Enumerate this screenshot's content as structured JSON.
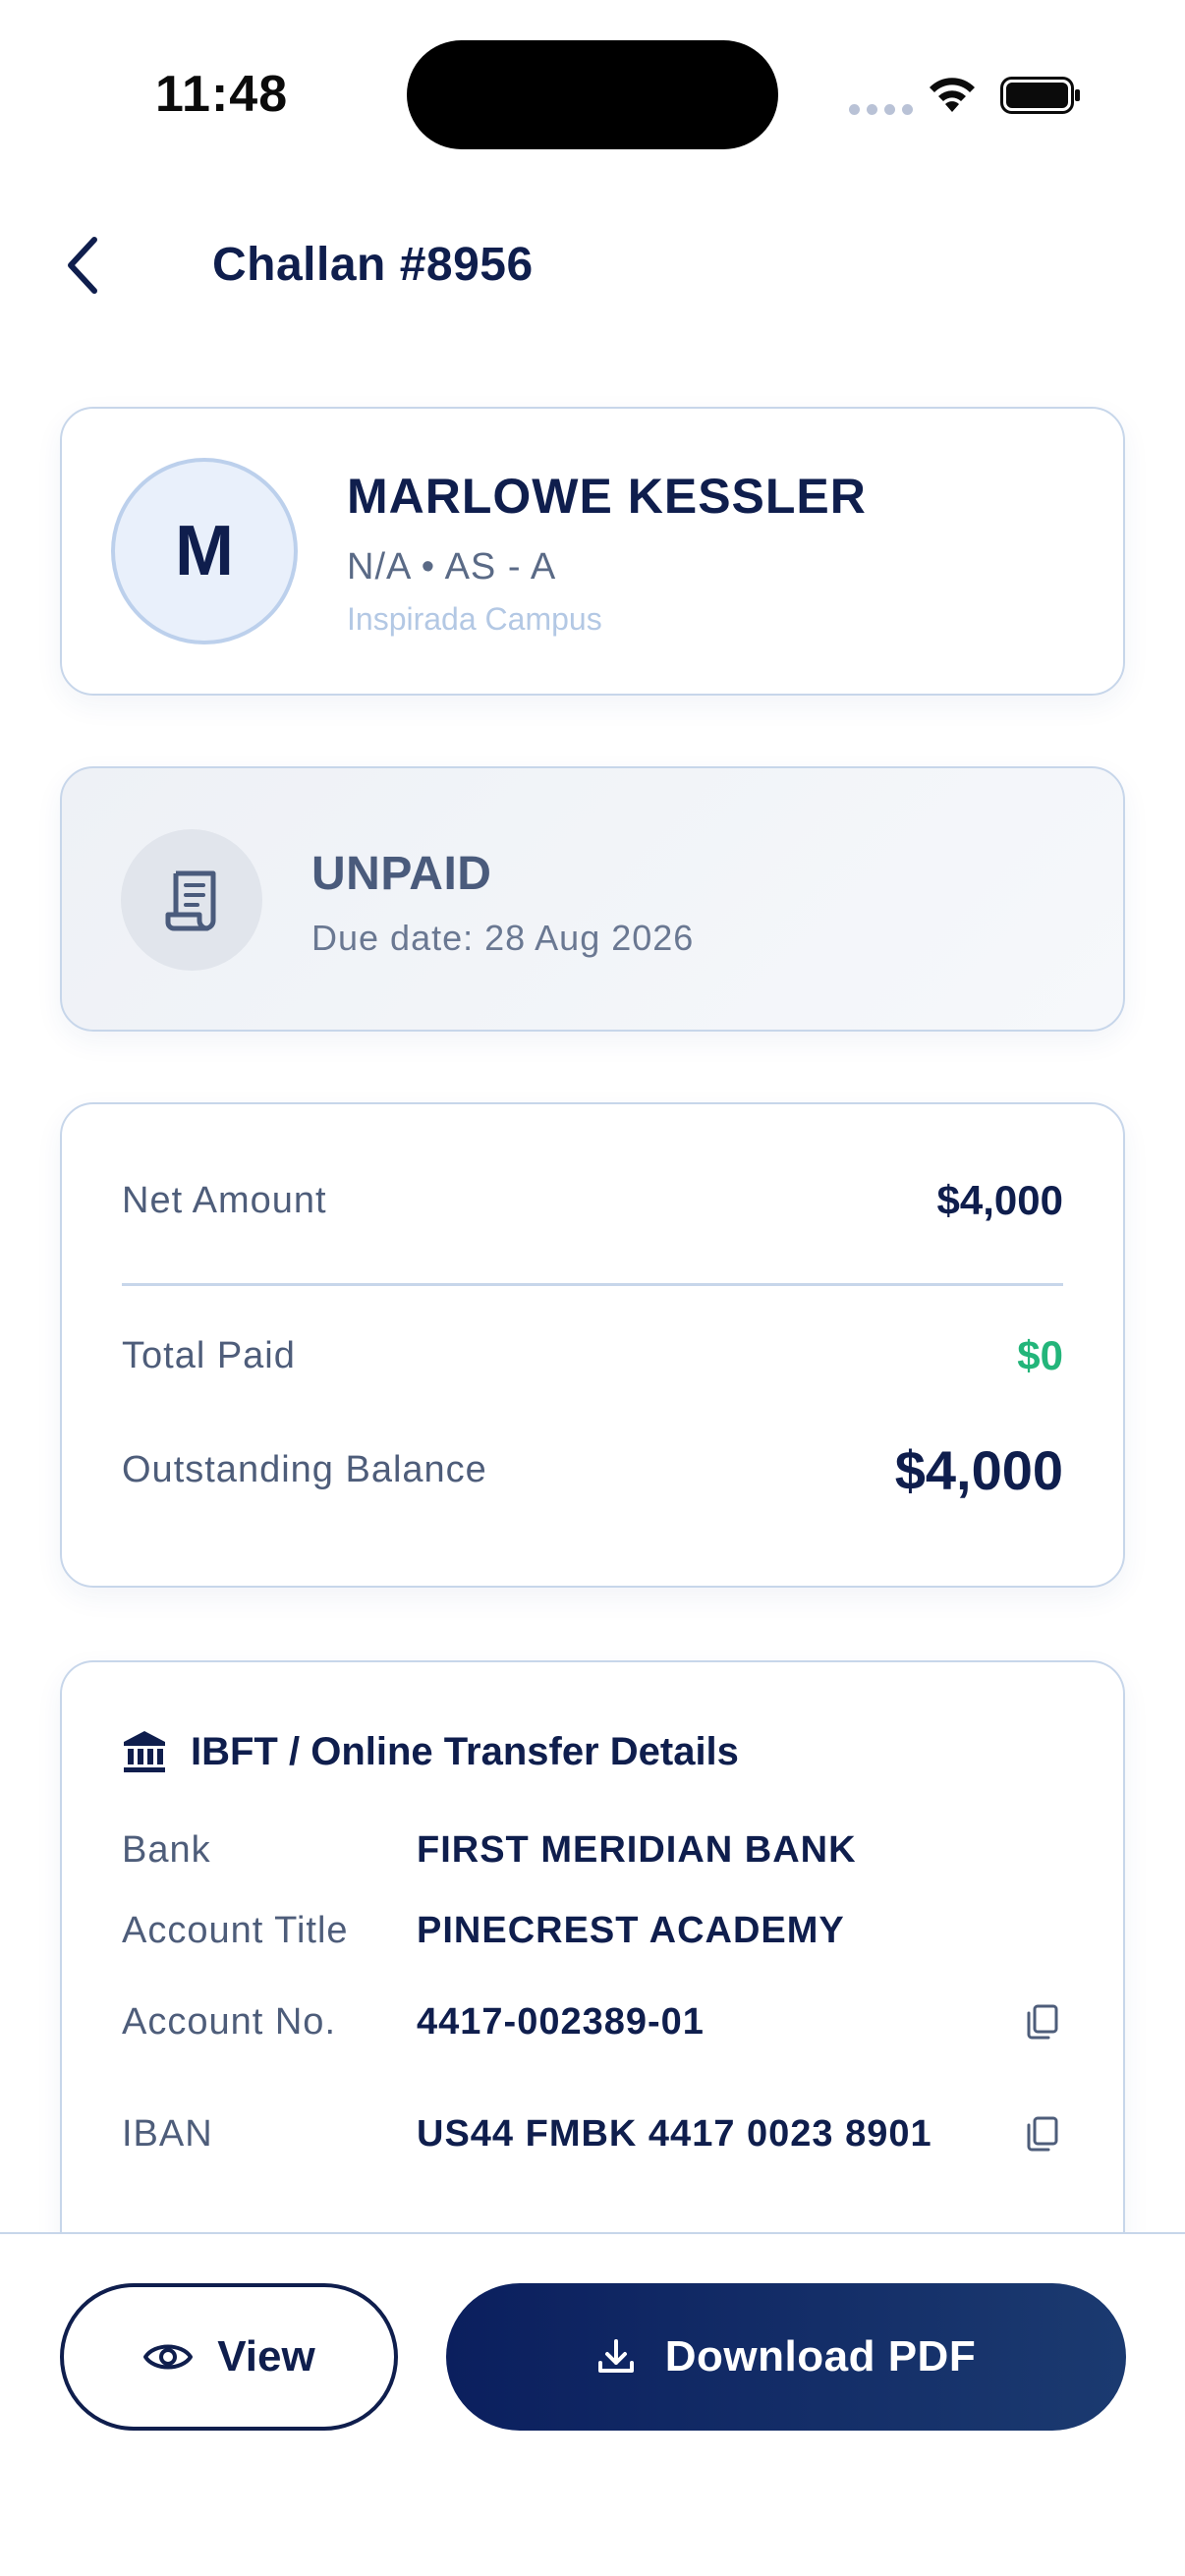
{
  "status_bar": {
    "time": "11:48"
  },
  "header": {
    "title": "Challan #8956"
  },
  "student": {
    "initial": "M",
    "name": "MARLOWE KESSLER",
    "meta": "N/A • AS - A",
    "campus": "Inspirada Campus"
  },
  "challan_status": {
    "label": "UNPAID",
    "due_date": "Due date: 28 Aug 2026",
    "icon": "receipt-icon"
  },
  "amounts": {
    "net_label": "Net Amount",
    "net_value": "$4,000",
    "paid_label": "Total Paid",
    "paid_value": "$0",
    "balance_label": "Outstanding Balance",
    "balance_value": "$4,000"
  },
  "bank": {
    "title": "IBFT / Online Transfer Details",
    "icon": "bank-icon",
    "rows": [
      {
        "label": "Bank",
        "value": "FIRST MERIDIAN BANK"
      },
      {
        "label": "Account Title",
        "value": "PINECREST ACADEMY"
      },
      {
        "label": "Account No.",
        "value": "4417-002389-01"
      },
      {
        "label": "IBAN",
        "value": "US44 FMBK 4417 0023 8901"
      }
    ]
  },
  "actions": {
    "view_label": "View",
    "download_label": "Download PDF"
  },
  "colors": {
    "primary": "#0f1e4d",
    "border": "#c7d6ea",
    "paid_green": "#23b57a",
    "campus_text": "#b3c8e4"
  }
}
